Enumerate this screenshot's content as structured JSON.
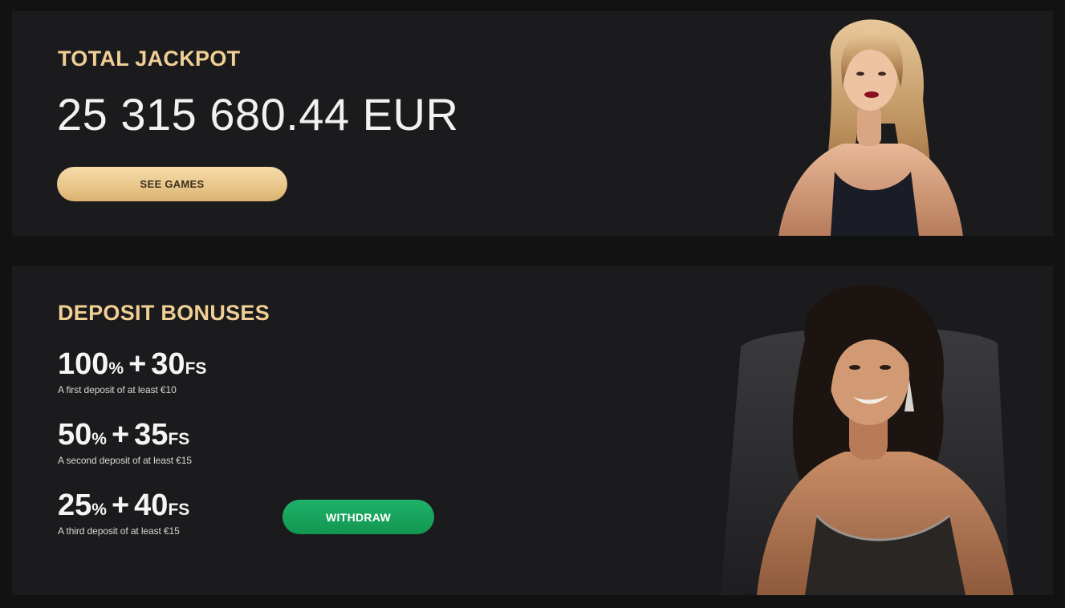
{
  "jackpot": {
    "title": "TOTAL JACKPOT",
    "amount": "25 315 680.44 EUR",
    "button_label": "SEE GAMES"
  },
  "bonuses": {
    "title": "DEPOSIT BONUSES",
    "items": [
      {
        "percent": "100",
        "percent_sign": "%",
        "plus": "+",
        "spins": "30",
        "spins_unit": "FS",
        "description": "A first deposit of at least €10"
      },
      {
        "percent": "50",
        "percent_sign": "%",
        "plus": "+",
        "spins": "35",
        "spins_unit": "FS",
        "description": "A second deposit of at least €15"
      },
      {
        "percent": "25",
        "percent_sign": "%",
        "plus": "+",
        "spins": "40",
        "spins_unit": "FS",
        "description": "A third deposit of at least €15"
      }
    ],
    "button_label": "WITHDRAW"
  },
  "colors": {
    "accent_gold": "#f0cf95",
    "button_green": "#12964f",
    "panel_bg": "#1b1b1d",
    "page_bg": "#121212"
  },
  "icons": {
    "figure_1": "model-portrait-blonde",
    "figure_2": "model-portrait-brunette"
  }
}
